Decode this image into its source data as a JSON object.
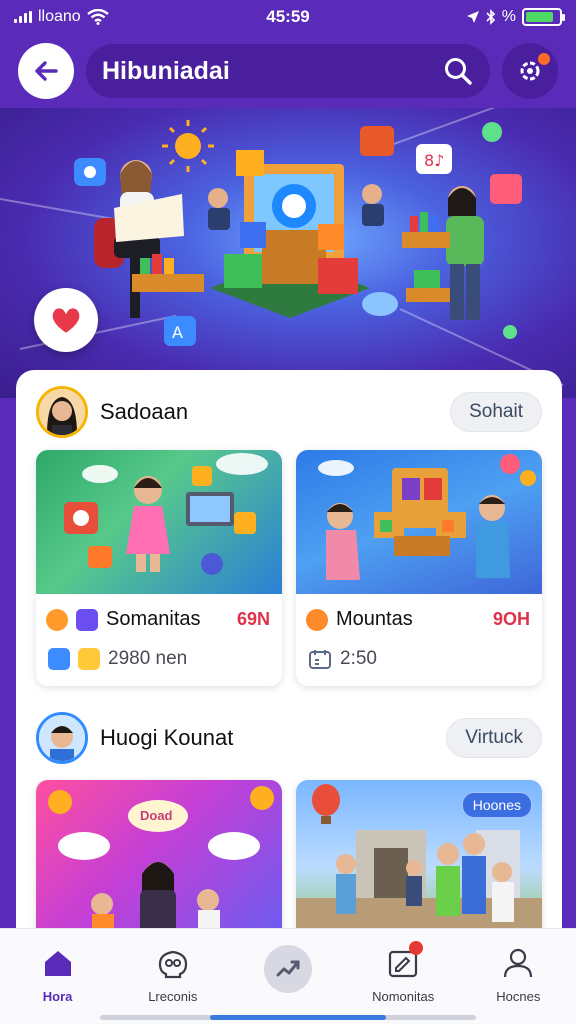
{
  "status_bar": {
    "carrier": "lloano",
    "time": "45:59",
    "battery_text": "%",
    "battery_level": 0.85
  },
  "header": {
    "title": "Hibuniadai"
  },
  "sections": [
    {
      "name": "Sadoaan",
      "action": "Sohait",
      "cards": [
        {
          "title": "Somanitas",
          "badge": "69N",
          "meta": "2980 nen"
        },
        {
          "title": "Mountas",
          "badge": "9OH",
          "meta": "2:50"
        }
      ]
    },
    {
      "name": "Huogi Kounat",
      "action": "Virtuck",
      "cards": [
        {
          "title": "",
          "badge": "",
          "meta": "",
          "cloud_text": "Doad"
        },
        {
          "title": "",
          "badge": "",
          "meta": "",
          "tag": "Hoones"
        }
      ]
    }
  ],
  "bottom_nav": [
    {
      "label": "Hora",
      "icon": "home-icon",
      "active": true
    },
    {
      "label": "Lreconis",
      "icon": "brain-icon",
      "active": false
    },
    {
      "label": "",
      "icon": "compose-icon",
      "active": false
    },
    {
      "label": "Nomonitas",
      "icon": "notes-icon",
      "active": false
    },
    {
      "label": "Hocnes",
      "icon": "profile-icon",
      "active": false
    }
  ],
  "colors": {
    "brand": "#5a2bb8",
    "badge": "#e0314b",
    "accent_orange": "#ff6a2c"
  }
}
